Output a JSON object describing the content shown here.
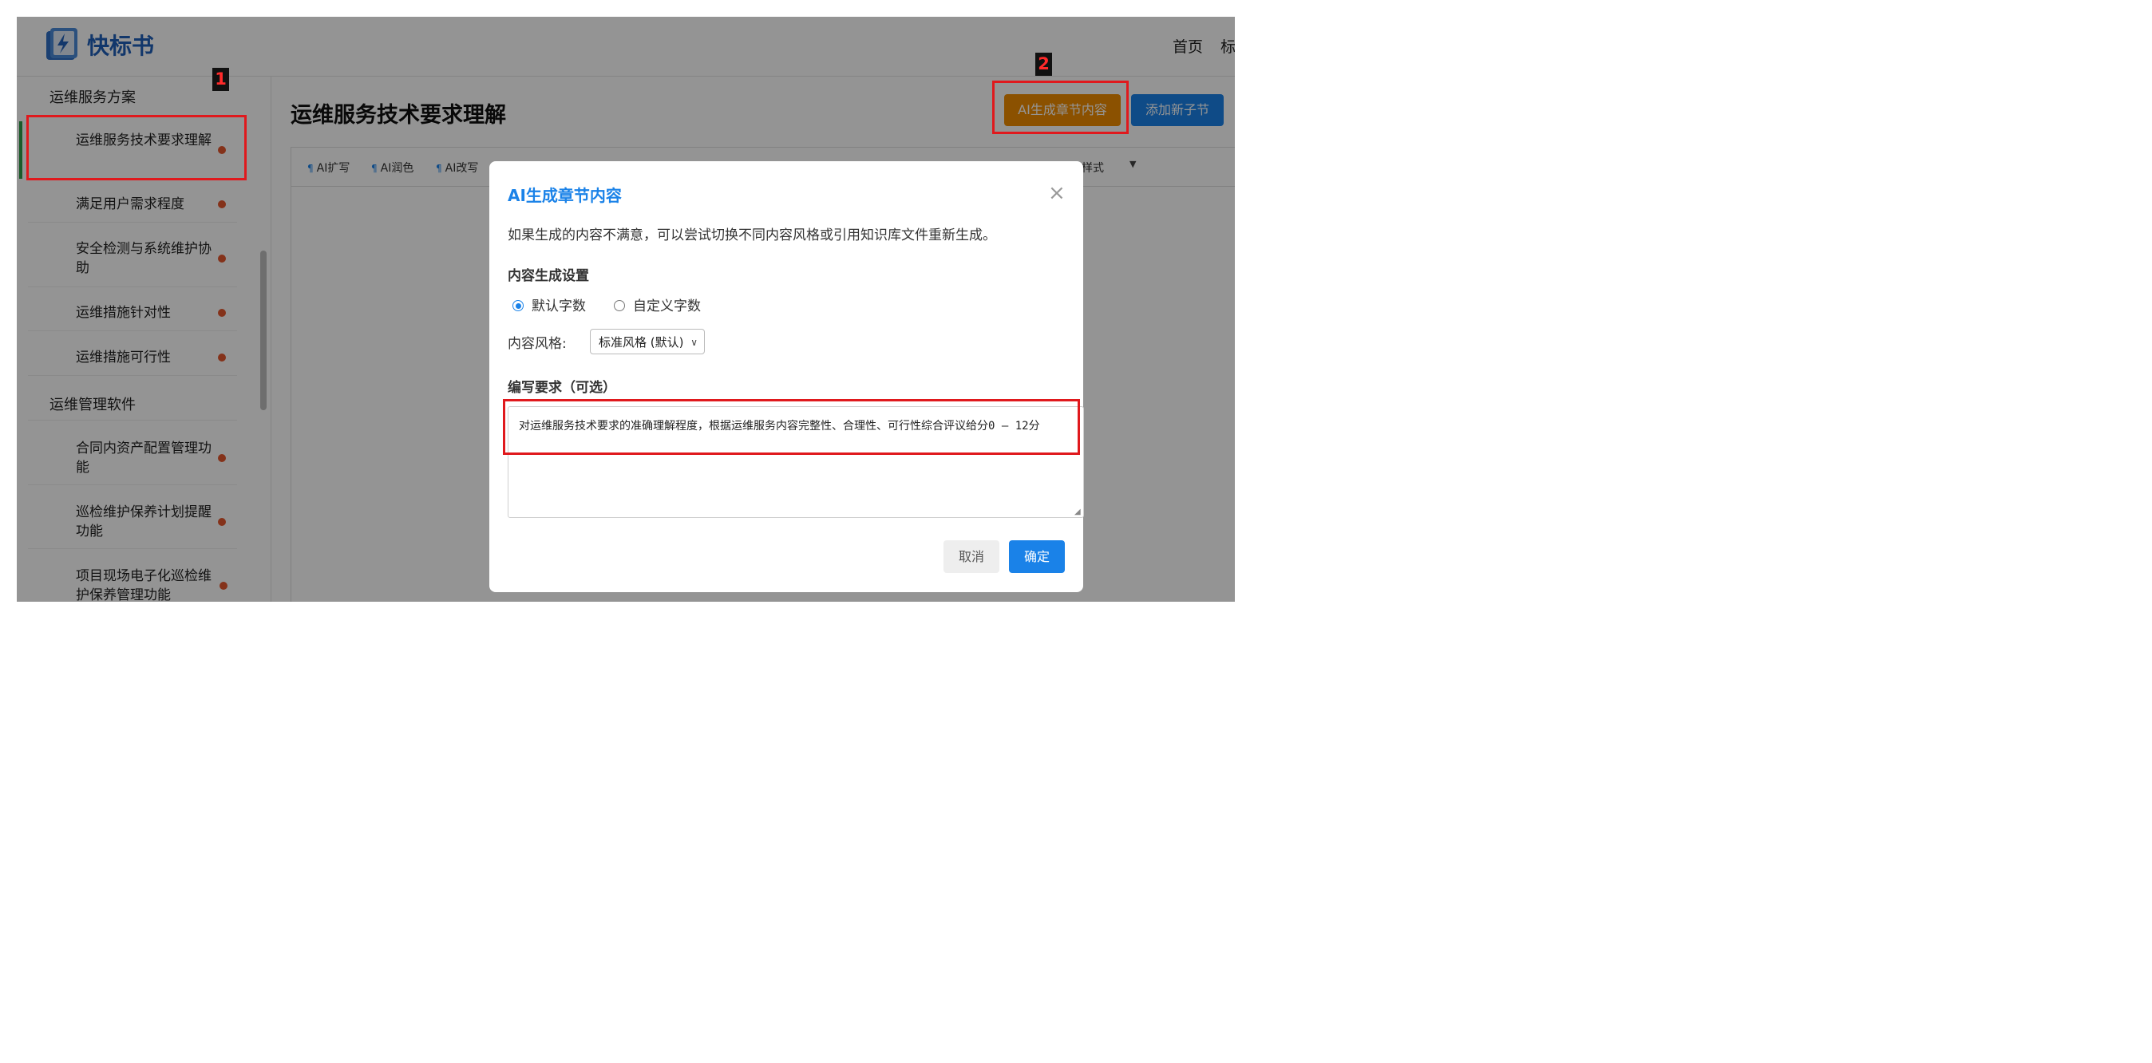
{
  "header": {
    "brand": "快标书",
    "nav": [
      "首页",
      "标"
    ]
  },
  "sidebar": {
    "sections": [
      {
        "title": "运维服务方案",
        "items": [
          {
            "label": "运维服务技术要求理解",
            "active": true
          },
          {
            "label": "满足用户需求程度"
          },
          {
            "label": "安全检测与系统维护协助"
          },
          {
            "label": "运维措施针对性"
          },
          {
            "label": "运维措施可行性"
          }
        ]
      },
      {
        "title": "运维管理软件",
        "items": [
          {
            "label": "合同内资产配置管理功能"
          },
          {
            "label": "巡检维护保养计划提醒功能"
          },
          {
            "label": "项目现场电子化巡检维护保养管理功能"
          }
        ]
      }
    ]
  },
  "main": {
    "title": "运维服务技术要求理解",
    "ai_button": "AI生成章节内容",
    "add_button": "添加新子节",
    "toolbar": [
      "AI扩写",
      "AI润色",
      "AI改写"
    ],
    "toolbar_style_label": "样式"
  },
  "modal": {
    "title": "AI生成章节内容",
    "close": "×",
    "description": "如果生成的内容不满意，可以尝试切换不同内容风格或引用知识库文件重新生成。",
    "settings_title": "内容生成设置",
    "radio_default": "默认字数",
    "radio_custom": "自定义字数",
    "style_label": "内容风格:",
    "style_value": "标准风格 (默认)",
    "requirements_label": "编写要求（可选）",
    "requirements_text": "对运维服务技术要求的准确理解程度，根据运维服务内容完整性、合理性、可行性综合评议给分0 – 12分",
    "cancel": "取消",
    "confirm": "确定"
  },
  "annotations": {
    "badge1": "1",
    "badge2": "2"
  },
  "colors": {
    "primary": "#1a82e8",
    "orange": "#f08c00",
    "dot": "#e4572e",
    "highlight": "#e0191d"
  }
}
